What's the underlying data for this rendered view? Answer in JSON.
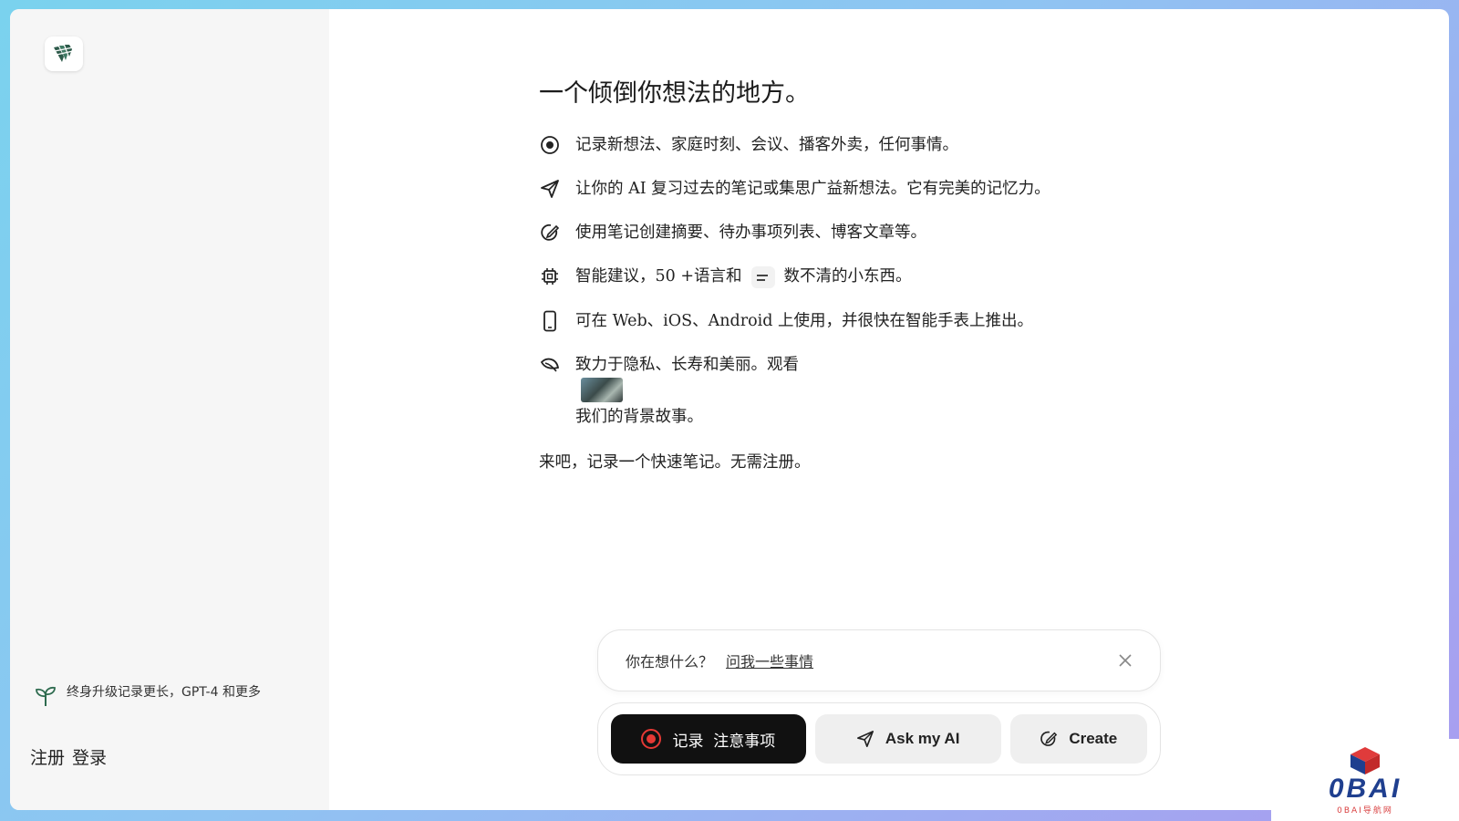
{
  "sidebar": {
    "upgrade_text": "终身升级记录更长，GPT-4 和更多",
    "signup_label": "注册",
    "login_label": "登录"
  },
  "main": {
    "headline": "一个倾倒你想法的地方。",
    "features": [
      {
        "icon": "record-circle-icon",
        "text": "记录新想法、家庭时刻、会议、播客外卖，任何事情。"
      },
      {
        "icon": "send-icon",
        "text": "让你的 AI 复习过去的笔记或集思广益新想法。它有完美的记忆力。"
      },
      {
        "icon": "edit-circle-icon",
        "text": "使用笔记创建摘要、待办事项列表、博客文章等。"
      },
      {
        "icon": "cpu-chip-icon",
        "text_before": "智能建议，50 +语言和",
        "text_after": "数不清的小东西。"
      },
      {
        "icon": "phone-icon",
        "text": "可在 Web、iOS、Android 上使用，并很快在智能手表上推出。"
      },
      {
        "icon": "leaf-icon",
        "text_before": "致力于隐私、长寿和美丽。观看",
        "text_after": "我们的背景故事。"
      }
    ],
    "cta": "来吧，记录一个快速笔记。无需注册。"
  },
  "prompt": {
    "question": "你在想什么？",
    "link": "问我一些事情"
  },
  "actions": {
    "record_label": "记录  注意事项",
    "ask_label": "Ask my AI",
    "create_label": "Create"
  },
  "watermark": {
    "brand": "0BAI",
    "subtitle": "0BAI导航网"
  },
  "colors": {
    "record_red": "#e53935",
    "primary_dark": "#111111",
    "watermark_blue": "#1f3f8f",
    "leaf_green": "#2e6b4f"
  }
}
